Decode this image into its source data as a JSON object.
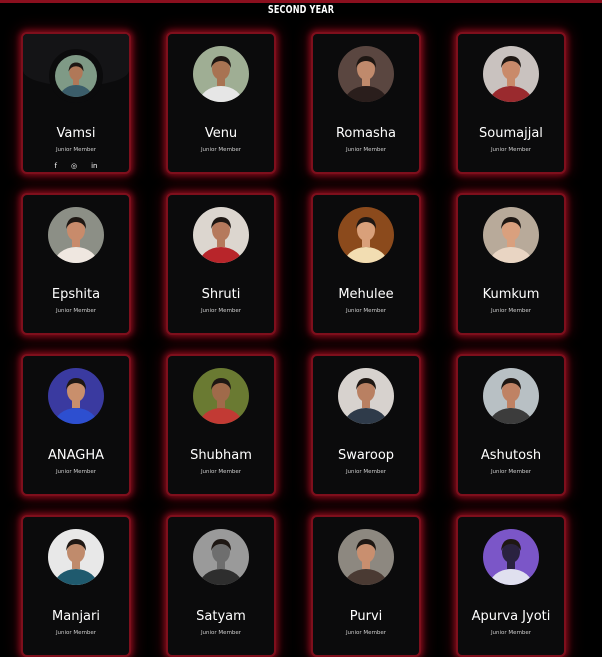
{
  "section_title": "SECOND YEAR",
  "colors": {
    "glow": "#c8142a",
    "card_bg": "#0b0b0c",
    "accent": "#7e0f1c"
  },
  "members": [
    {
      "name": "Vamsi",
      "role": "Junior Member",
      "bg": "#7f9a86",
      "skin": "#b07858",
      "shirt": "#3b5d6a"
    },
    {
      "name": "Venu",
      "role": "Junior Member",
      "bg": "#9fae94",
      "skin": "#a87352",
      "shirt": "#e6e6e6"
    },
    {
      "name": "Romasha",
      "role": "Junior Member",
      "bg": "#5a4640",
      "skin": "#c08a6c",
      "shirt": "#2a1e1c"
    },
    {
      "name": "Soumajjal",
      "role": "Junior Member",
      "bg": "#c9c2bf",
      "skin": "#c98a6a",
      "shirt": "#9a2a2e"
    },
    {
      "name": "Epshita",
      "role": "Junior Member",
      "bg": "#8c8f86",
      "skin": "#c88b6b",
      "shirt": "#efe7e0"
    },
    {
      "name": "Shruti",
      "role": "Junior Member",
      "bg": "#dcd6cf",
      "skin": "#b5795c",
      "shirt": "#b8252a"
    },
    {
      "name": "Mehulee",
      "role": "Junior Member",
      "bg": "#8b4a1c",
      "skin": "#d9a07a",
      "shirt": "#f2ddb2"
    },
    {
      "name": "Kumkum",
      "role": "Junior Member",
      "bg": "#b8aa9a",
      "skin": "#d9a07e",
      "shirt": "#e9d5c3"
    },
    {
      "name": "ANAGHA",
      "role": "Junior Member",
      "bg": "#3a3aa0",
      "skin": "#c98f6c",
      "shirt": "#2d4fd0"
    },
    {
      "name": "Shubham",
      "role": "Junior Member",
      "bg": "#6a7a32",
      "skin": "#a06a4a",
      "shirt": "#c23a34"
    },
    {
      "name": "Swaroop",
      "role": "Junior Member",
      "bg": "#d7d2ce",
      "skin": "#b98062",
      "shirt": "#2f3b4a"
    },
    {
      "name": "Ashutosh",
      "role": "Junior Member",
      "bg": "#b8c0c4",
      "skin": "#bf8264",
      "shirt": "#3c3c3c"
    },
    {
      "name": "Manjari",
      "role": "Junior Member",
      "bg": "#e8e8e8",
      "skin": "#c08b6c",
      "shirt": "#1f5a6e"
    },
    {
      "name": "Satyam",
      "role": "Junior Member",
      "bg": "#9a9a9a",
      "skin": "#6e6e6e",
      "shirt": "#2e2e2e"
    },
    {
      "name": "Purvi",
      "role": "Junior Member",
      "bg": "#8d8880",
      "skin": "#c98f6f",
      "shirt": "#4a3a33"
    },
    {
      "name": "Apurva Jyoti",
      "role": "Junior Member",
      "bg": "#7b56c8",
      "skin": "#2a2240",
      "shirt": "#e0e0ef"
    }
  ],
  "social_icons": [
    "facebook-icon",
    "instagram-icon",
    "linkedin-icon"
  ],
  "social_glyphs": [
    "f",
    "◎",
    "in"
  ]
}
